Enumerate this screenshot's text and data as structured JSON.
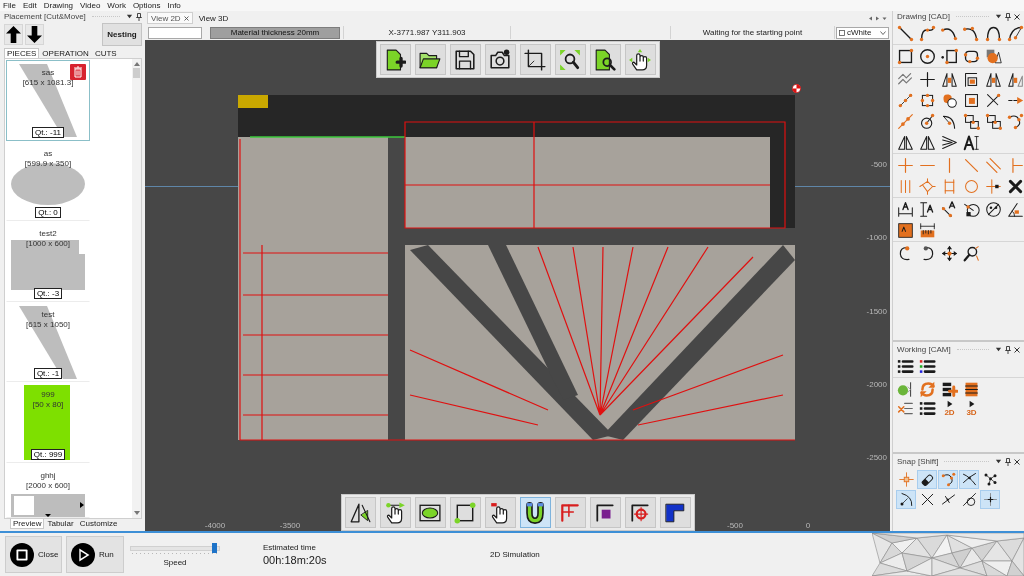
{
  "menu": [
    "File",
    "Edit",
    "Drawing",
    "Video",
    "Work",
    "Options",
    "Info"
  ],
  "placement_panel": {
    "title": "Placement [Cut&Move]",
    "nesting_button": "Nesting",
    "tabs": [
      {
        "label": "PIECES",
        "selected": true
      },
      {
        "label": "OPERATION",
        "selected": false
      },
      {
        "label": "CUTS",
        "selected": false
      }
    ],
    "pieces": [
      {
        "name": "sas",
        "size": "[615 x 1081.3]",
        "quantity": "Qt.: -11",
        "kind": "trapezoid",
        "color": "#bdbdbd",
        "selected": true
      },
      {
        "name": "as",
        "size": "[599.9 x 350]",
        "quantity": "Qt.: 0",
        "kind": "ellipse",
        "color": "#bdbdbd",
        "selected": false
      },
      {
        "name": "test2",
        "size": "[1000 x 600]",
        "quantity": "Qt.: -3",
        "kind": "notched",
        "color": "#bdbdbd",
        "selected": false
      },
      {
        "name": "test",
        "size": "[615 x 1050]",
        "quantity": "Qt.: -1",
        "kind": "trapezoid",
        "color": "#bdbdbd",
        "selected": false
      },
      {
        "name": "999",
        "size": "[50 x 80]",
        "quantity": "Qt.: 999",
        "kind": "rectangle",
        "color": "#7ee000",
        "selected": false
      },
      {
        "name": "ghhj",
        "size": "[2000 x 600]",
        "kind": "bar",
        "color": "#bdbdbd",
        "selected": false
      }
    ],
    "view_tabs": [
      {
        "label": "Preview",
        "selected": true
      },
      {
        "label": "Tabular",
        "selected": false
      },
      {
        "label": "Customize",
        "selected": false
      }
    ]
  },
  "document_tabs": [
    {
      "label": "View 2D",
      "selected": true
    },
    {
      "label": "View 3D",
      "selected": false
    }
  ],
  "status_bar": {
    "material": "Material thickness 20mm",
    "coordinates": "X-3771.987 Y311.903",
    "message": "Waiting for the starting point",
    "color_option": "cWhite"
  },
  "top_toolbar": [
    {
      "kind": "new"
    },
    {
      "kind": "open"
    },
    {
      "kind": "save"
    },
    {
      "kind": "snapshot"
    },
    {
      "kind": "frame"
    },
    {
      "kind": "zoomfit"
    },
    {
      "kind": "zoompage"
    },
    {
      "kind": "pan"
    }
  ],
  "canvas": {
    "vertical_ruler": [
      "-500",
      "-1000",
      "-1500",
      "-2000",
      "-2500"
    ],
    "horizontal_ruler": [
      "-4000",
      "-3500",
      "-500",
      "0"
    ]
  },
  "bottom_toolbar": [
    {
      "kind": "mirror",
      "selected": false
    },
    {
      "kind": "drag",
      "selected": false
    },
    {
      "kind": "ellipse",
      "selected": false
    },
    {
      "kind": "square",
      "selected": false
    },
    {
      "kind": "handtag",
      "selected": false
    },
    {
      "kind": "magnet",
      "selected": true
    },
    {
      "kind": "leadcross",
      "selected": false
    },
    {
      "kind": "leadsquare",
      "selected": false
    },
    {
      "kind": "leadcircle",
      "selected": false
    },
    {
      "kind": "leadfill",
      "selected": false
    }
  ],
  "drawing_panel": {
    "title": "Drawing [CAD]",
    "groups": [
      {
        "rows": [
          [
            {
              "kind": "line"
            },
            {
              "kind": "curve"
            },
            {
              "kind": "arc"
            },
            {
              "kind": "arcpoints"
            },
            {
              "kind": "semiarc"
            },
            {
              "kind": "arcradius"
            }
          ]
        ]
      },
      {
        "rows": [
          [
            {
              "kind": "rect"
            },
            {
              "kind": "circle"
            },
            {
              "kind": "pointrect"
            },
            {
              "kind": "roundrect"
            },
            {
              "kind": "shapes"
            }
          ]
        ]
      },
      {
        "rows": [
          [
            {
              "kind": "offset"
            },
            {
              "kind": "cross"
            },
            {
              "kind": "mirrorbox"
            },
            {
              "kind": "trim"
            },
            {
              "kind": "mirrorbox"
            },
            {
              "kind": "mirrorhalf"
            }
          ],
          [
            {
              "kind": "chain"
            },
            {
              "kind": "boxpoints"
            },
            {
              "kind": "blob"
            },
            {
              "kind": "boxpoint"
            },
            {
              "kind": "intersect"
            },
            {
              "kind": "extend"
            }
          ],
          [
            {
              "kind": "segment"
            },
            {
              "kind": "rotate"
            },
            {
              "kind": "arcpick"
            },
            {
              "kind": "nodes"
            },
            {
              "kind": "nodes"
            },
            {
              "kind": "curvepoints"
            }
          ],
          [
            {
              "kind": "triangles"
            },
            {
              "kind": "triangles"
            },
            {
              "kind": "lines"
            },
            {
              "kind": "text"
            }
          ]
        ]
      },
      {
        "rows": [
          [
            {
              "kind": "plus"
            },
            {
              "kind": "horizontal"
            },
            {
              "kind": "vertical"
            },
            {
              "kind": "diagonal"
            },
            {
              "kind": "parallel"
            },
            {
              "kind": "tee"
            }
          ],
          [
            {
              "kind": "triple"
            },
            {
              "kind": "tilted"
            },
            {
              "kind": "squarecons"
            },
            {
              "kind": "ring"
            },
            {
              "kind": "pointon"
            },
            {
              "kind": "remove"
            }
          ]
        ]
      },
      {
        "rows": [
          [
            {
              "kind": "dimh"
            },
            {
              "kind": "dimv"
            },
            {
              "kind": "dima"
            },
            {
              "kind": "dimr"
            },
            {
              "kind": "dimd"
            },
            {
              "kind": "dimang"
            }
          ],
          [
            {
              "kind": "label"
            },
            {
              "kind": "ruler"
            }
          ]
        ]
      },
      {
        "rows": [
          [
            {
              "kind": "undo"
            },
            {
              "kind": "redo"
            },
            {
              "kind": "move"
            },
            {
              "kind": "zoomwin"
            }
          ]
        ]
      }
    ]
  },
  "working_panel": {
    "title": "Working [CAM]",
    "groups": [
      {
        "rows": [
          [
            {
              "kind": "list"
            },
            {
              "kind": "colorlist"
            }
          ]
        ]
      },
      {
        "rows": [
          [
            {
              "kind": "sphere"
            },
            {
              "kind": "refresh"
            },
            {
              "kind": "addlayer"
            },
            {
              "kind": "layer"
            }
          ],
          [
            {
              "kind": "removelist"
            },
            {
              "kind": "list"
            },
            {
              "kind": "play",
              "label": "2D"
            },
            {
              "kind": "play",
              "label": "3D"
            }
          ]
        ]
      }
    ]
  },
  "snap_panel": {
    "title": "Snap [Shift]",
    "tools": [
      {
        "kind": "midcross",
        "selected": false
      },
      {
        "kind": "eraser",
        "selected": true
      },
      {
        "kind": "curvepoints",
        "selected": true
      },
      {
        "kind": "intersectcurve",
        "selected": true
      },
      {
        "kind": "network",
        "selected": false
      },
      {
        "kind": "nearest",
        "selected": true
      },
      {
        "kind": "xcross",
        "selected": false
      },
      {
        "kind": "perp",
        "selected": false
      },
      {
        "kind": "tangent",
        "selected": false
      },
      {
        "kind": "gridpoint",
        "selected": true
      }
    ]
  },
  "bottom_bar": {
    "close_button": "Close",
    "run_button": "Run",
    "speed": {
      "label": "Speed",
      "level": 0.97
    },
    "estimate_label": "Estimated time",
    "estimate": "00h:18m:20s",
    "mode": "2D Simulation"
  }
}
